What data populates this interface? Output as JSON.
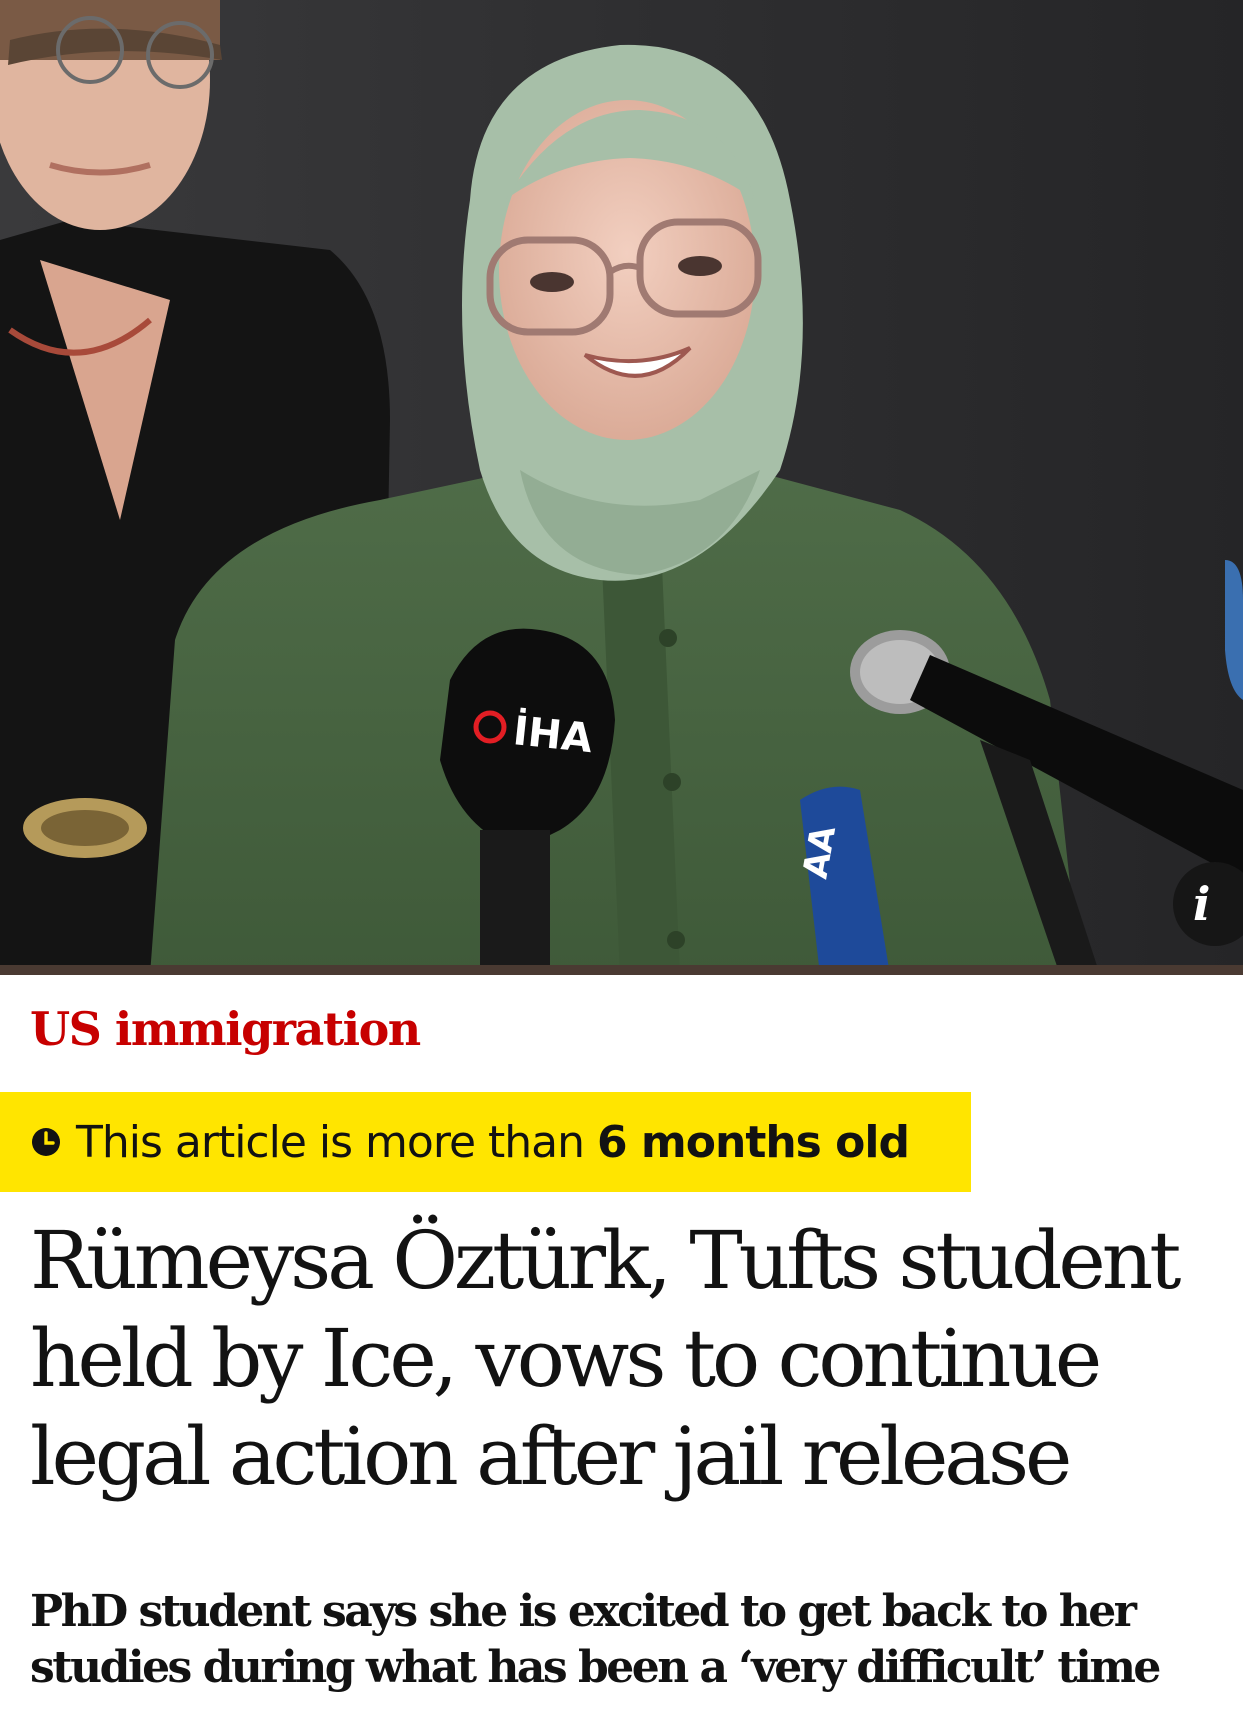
{
  "hero": {
    "mic_logo_left": "İHA",
    "mic_logo_right": "AA",
    "info_button_label": "i"
  },
  "article": {
    "section": "US immigration",
    "age_notice_prefix": "This article is more than ",
    "age_notice_strong": "6 months old",
    "headline_lines": [
      "Rümeysa Öztürk, Tufts student",
      "held by Ice, vows to continue",
      "legal action after jail release"
    ],
    "standfirst_lines": [
      "PhD student says she is excited to get back to her",
      "studies during what has been a ‘very difficult’ time"
    ]
  },
  "colors": {
    "section_red": "#c70000",
    "banner_yellow": "#ffe500",
    "text_dark": "#121212"
  },
  "icons": {
    "age_notice": "clock-icon",
    "info": "info-icon"
  }
}
